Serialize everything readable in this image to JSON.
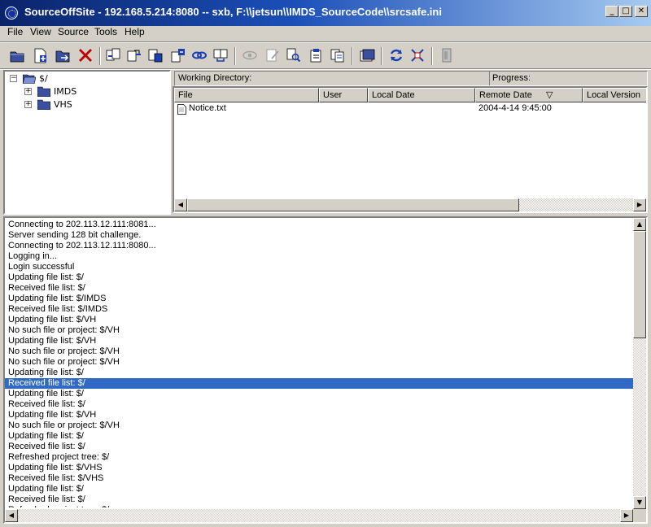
{
  "window": {
    "title": "SourceOffSite - 192.168.5.214:8080 -- sxb, F:\\\\jetsun\\\\IMDS_SourceCode\\\\srcsafe.ini",
    "minimize": "_",
    "maximize": "□",
    "close": "✕"
  },
  "menu": {
    "file": "File",
    "view": "View",
    "source": "Source",
    "tools": "Tools",
    "help": "Help"
  },
  "tree": {
    "root": "$/",
    "children": [
      "IMDS",
      "VHS"
    ]
  },
  "file_pane": {
    "working_directory_label": "Working Directory:",
    "progress_label": "Progress:",
    "columns": [
      "File",
      "User",
      "Local Date",
      "Remote Date",
      "Local Version"
    ],
    "sort_indicator": "▽",
    "rows": [
      {
        "file": "Notice.txt",
        "user": "",
        "local_date": "",
        "remote_date": "2004-4-14 9:45:00",
        "local_version": ""
      }
    ]
  },
  "log": {
    "selected_index": 15,
    "lines": [
      "Connecting to 202.113.12.111:8081...",
      "Server sending 128 bit challenge.",
      "Connecting to 202.113.12.111:8080...",
      "Logging in...",
      "Login successful",
      "Updating file list: $/",
      "Received file list: $/",
      "Updating file list: $/IMDS",
      "Received file list: $/IMDS",
      "Updating file list: $/VH",
      "No such file or project: $/VH",
      "Updating file list: $/VH",
      "No such file or project: $/VH",
      "No such file or project: $/VH",
      "Updating file list: $/",
      "Received file list: $/",
      "Updating file list: $/",
      "Received file list: $/",
      "Updating file list: $/VH",
      "No such file or project: $/VH",
      "Updating file list: $/",
      "Received file list: $/",
      "Refreshed project tree: $/",
      "Updating file list: $/VHS",
      "Received file list: $/VHS",
      "Updating file list: $/",
      "Received file list: $/",
      "Refreshed project tree: $/"
    ]
  },
  "toolbar_icons": [
    "open-folder-icon",
    "add-file-icon",
    "add-folder-icon",
    "delete-icon",
    "check-out-icon",
    "check-in-icon",
    "undo-check-out-icon",
    "get-latest-icon",
    "share-link-icon",
    "merge-icon",
    "view-icon",
    "edit-icon",
    "find-icon",
    "properties-icon",
    "history-icon",
    "label-icon",
    "refresh-icon",
    "diff-icon",
    "exit-icon"
  ],
  "colors": {
    "selection": "#316ac5",
    "title_start": "#0a246a",
    "title_end": "#a6caf0"
  }
}
